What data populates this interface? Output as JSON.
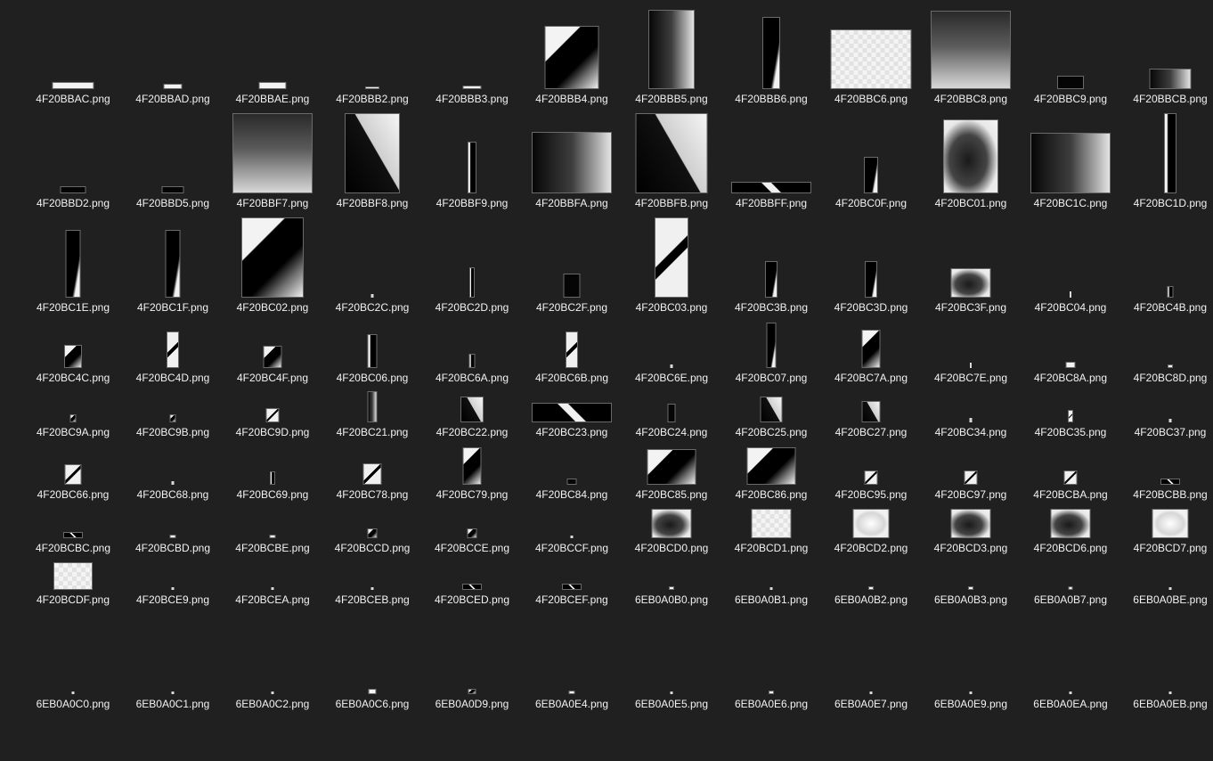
{
  "files": [
    "4F20BBAC.png",
    "4F20BBAD.png",
    "4F20BBAE.png",
    "4F20BBB2.png",
    "4F20BBB3.png",
    "4F20BBB4.png",
    "4F20BBB5.png",
    "4F20BBB6.png",
    "4F20BBC6.png",
    "4F20BBC8.png",
    "4F20BBC9.png",
    "4F20BBCB.png",
    "4F20BBD2.png",
    "4F20BBD5.png",
    "4F20BBF7.png",
    "4F20BBF8.png",
    "4F20BBF9.png",
    "4F20BBFA.png",
    "4F20BBFB.png",
    "4F20BBFF.png",
    "4F20BC0F.png",
    "4F20BC01.png",
    "4F20BC1C.png",
    "4F20BC1D.png",
    "4F20BC1E.png",
    "4F20BC1F.png",
    "4F20BC02.png",
    "4F20BC2C.png",
    "4F20BC2D.png",
    "4F20BC2F.png",
    "4F20BC03.png",
    "4F20BC3B.png",
    "4F20BC3D.png",
    "4F20BC3F.png",
    "4F20BC04.png",
    "4F20BC4B.png",
    "4F20BC4C.png",
    "4F20BC4D.png",
    "4F20BC4F.png",
    "4F20BC06.png",
    "4F20BC6A.png",
    "4F20BC6B.png",
    "4F20BC6E.png",
    "4F20BC07.png",
    "4F20BC7A.png",
    "4F20BC7E.png",
    "4F20BC8A.png",
    "4F20BC8D.png",
    "4F20BC9A.png",
    "4F20BC9B.png",
    "4F20BC9D.png",
    "4F20BC21.png",
    "4F20BC22.png",
    "4F20BC23.png",
    "4F20BC24.png",
    "4F20BC25.png",
    "4F20BC27.png",
    "4F20BC34.png",
    "4F20BC35.png",
    "4F20BC37.png",
    "4F20BC66.png",
    "4F20BC68.png",
    "4F20BC69.png",
    "4F20BC78.png",
    "4F20BC79.png",
    "4F20BC84.png",
    "4F20BC85.png",
    "4F20BC86.png",
    "4F20BC95.png",
    "4F20BC97.png",
    "4F20BCBA.png",
    "4F20BCBB.png",
    "4F20BCBC.png",
    "4F20BCBD.png",
    "4F20BCBE.png",
    "4F20BCCD.png",
    "4F20BCCE.png",
    "4F20BCCF.png",
    "4F20BCD0.png",
    "4F20BCD1.png",
    "4F20BCD2.png",
    "4F20BCD3.png",
    "4F20BCD6.png",
    "4F20BCD7.png",
    "4F20BCDF.png",
    "4F20BCE9.png",
    "4F20BCEA.png",
    "4F20BCEB.png",
    "4F20BCED.png",
    "4F20BCEF.png",
    "6EB0A0B0.png",
    "6EB0A0B1.png",
    "6EB0A0B2.png",
    "6EB0A0B3.png",
    "6EB0A0B7.png",
    "6EB0A0BE.png",
    "6EB0A0C0.png",
    "6EB0A0C1.png",
    "6EB0A0C2.png",
    "6EB0A0C6.png",
    "6EB0A0D9.png",
    "6EB0A0E4.png",
    "6EB0A0E5.png",
    "6EB0A0E6.png",
    "6EB0A0E7.png",
    "6EB0A0E9.png",
    "6EB0A0EA.png",
    "6EB0A0EB.png"
  ]
}
